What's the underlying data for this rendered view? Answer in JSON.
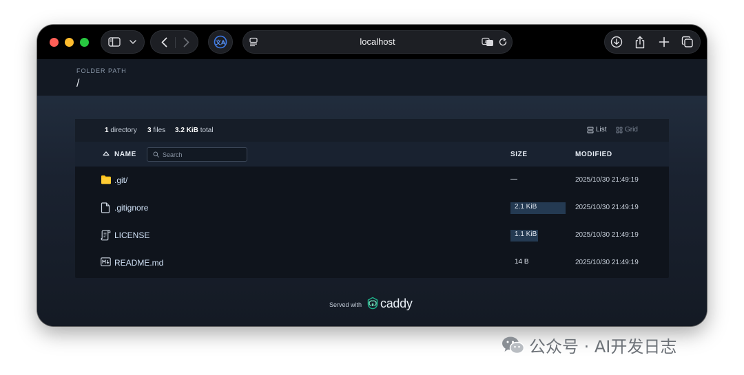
{
  "browser": {
    "address": "localhost",
    "colors": {
      "titlebar": "#000000",
      "pill": "#1d1f24",
      "ext_accent": "#2f6fe0"
    }
  },
  "header": {
    "label": "FOLDER PATH",
    "path": "/"
  },
  "summary": {
    "dir_count": "1",
    "dir_label": "directory",
    "file_count": "3",
    "file_label": "files",
    "total_size": "3.2 KiB",
    "total_label": "total"
  },
  "view": {
    "list_label": "List",
    "grid_label": "Grid"
  },
  "table": {
    "col_name": "NAME",
    "col_size": "SIZE",
    "col_modified": "MODIFIED",
    "search_placeholder": "Search",
    "rows": [
      {
        "icon": "folder-icon",
        "name": ".git/",
        "size": "—",
        "modified": "2025/10/30 21:49:19",
        "size_fraction": 0
      },
      {
        "icon": "file-icon",
        "name": ".gitignore",
        "size": "2.1 KiB",
        "modified": "2025/10/30 21:49:19",
        "size_fraction": 1.0
      },
      {
        "icon": "license-icon",
        "name": "LICENSE",
        "size": "1.1 KiB",
        "modified": "2025/10/30 21:49:19",
        "size_fraction": 0.5
      },
      {
        "icon": "markdown-icon",
        "name": "README.md",
        "size": "14 B",
        "modified": "2025/10/30 21:49:19",
        "size_fraction": 0.0065
      }
    ]
  },
  "footer": {
    "served_with": "Served with",
    "brand": "caddy"
  },
  "watermark": {
    "text": "公众号 · AI开发日志"
  }
}
